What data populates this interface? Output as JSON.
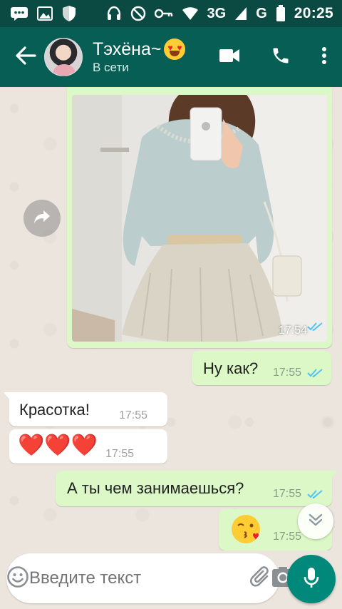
{
  "status_bar": {
    "time": "20:25",
    "network_3g": "3G",
    "network_g": "G",
    "icons": [
      "message-icon",
      "image-icon",
      "shield-icon",
      "headset-icon",
      "do-not-disturb-icon",
      "key-icon",
      "wifi-icon",
      "signal-icon",
      "battery-icon"
    ]
  },
  "header": {
    "contact_name": "Тэхёна~",
    "contact_emoji": "heart-eyes-emoji",
    "status": "В сети",
    "icons": [
      "back-arrow-icon",
      "video-call-icon",
      "phone-icon",
      "more-vert-icon"
    ]
  },
  "messages": [
    {
      "direction": "out",
      "type": "image",
      "time": "17:54",
      "read": true
    },
    {
      "direction": "out",
      "type": "text",
      "text": "Ну как?",
      "time": "17:55",
      "read": true
    },
    {
      "direction": "in",
      "type": "text",
      "text": "Красотка!",
      "time": "17:55"
    },
    {
      "direction": "in",
      "type": "emoji",
      "emoji": "❤️❤️❤️",
      "time": "17:55"
    },
    {
      "direction": "out",
      "type": "text",
      "text": "А ты чем занимаешься?",
      "time": "17:55",
      "read": true
    },
    {
      "direction": "out",
      "type": "emoji",
      "emoji": "kissing-heart-emoji",
      "time": "17:55",
      "read": true
    }
  ],
  "composer": {
    "placeholder": "Введите текст",
    "icons": [
      "emoji-icon",
      "paperclip-icon",
      "camera-icon",
      "microphone-icon"
    ]
  },
  "colors": {
    "status_bar": "#0b4a43",
    "app_bar": "#075e54",
    "chat_background": "#ece5dd",
    "outgoing_bubble": "#dcf8c6",
    "incoming_bubble": "#ffffff",
    "read_ticks": "#4fc3f7",
    "mic_button": "#00897b"
  }
}
